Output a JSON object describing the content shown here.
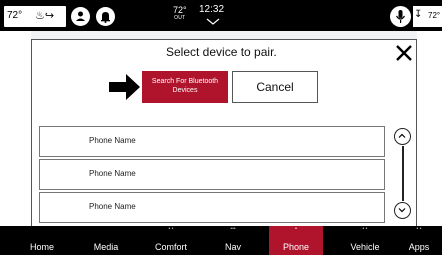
{
  "status_bar": {
    "driver_temp": "72°",
    "outside_temp": "72°",
    "outside_label": "OUT",
    "time": "12:32",
    "passenger_temp": "72°"
  },
  "dialog": {
    "title": "Select device to pair.",
    "search_button": "Search For Bluetooth Devices",
    "cancel_button": "Cancel",
    "devices": [
      {
        "name": "Phone Name"
      },
      {
        "name": "Phone Name"
      },
      {
        "name": "Phone Name"
      }
    ]
  },
  "nav": {
    "items": [
      {
        "label": "Home"
      },
      {
        "label": "Media"
      },
      {
        "label": "Comfort"
      },
      {
        "label": "Nav"
      },
      {
        "label": "Phone"
      },
      {
        "label": "Vehicle"
      },
      {
        "label": "Apps"
      }
    ],
    "active": "Phone"
  },
  "colors": {
    "accent": "#b0142c",
    "bar": "#000000"
  }
}
